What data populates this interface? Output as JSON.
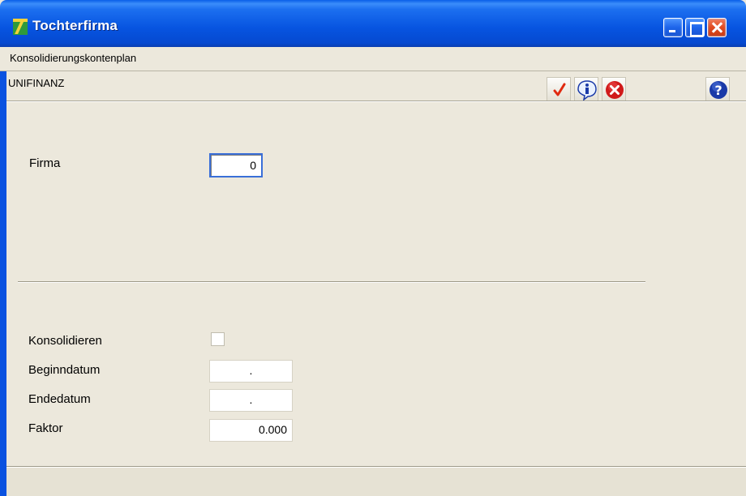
{
  "window": {
    "title": "Tochterfirma"
  },
  "menu": {
    "items": [
      "Konsolidierungskontenplan"
    ]
  },
  "toolbar": {
    "company": "UNIFINANZ",
    "buttons": [
      {
        "name": "ok",
        "icon": "checkmark-icon",
        "color": "#e02a10"
      },
      {
        "name": "info",
        "icon": "info-icon",
        "color": "#1a3aa8"
      },
      {
        "name": "cancel",
        "icon": "cancel-icon",
        "color": "#d01a1a"
      },
      {
        "name": "help",
        "icon": "help-icon",
        "color": "#1a3aa8"
      }
    ]
  },
  "form": {
    "firma_label": "Firma",
    "firma_value": "0",
    "konsolidieren_label": "Konsolidieren",
    "konsolidieren_checked": false,
    "beginndatum_label": "Beginndatum",
    "beginndatum_value": ".",
    "endedatum_label": "Endedatum",
    "endedatum_value": ".",
    "faktor_label": "Faktor",
    "faktor_value": "0.000"
  }
}
